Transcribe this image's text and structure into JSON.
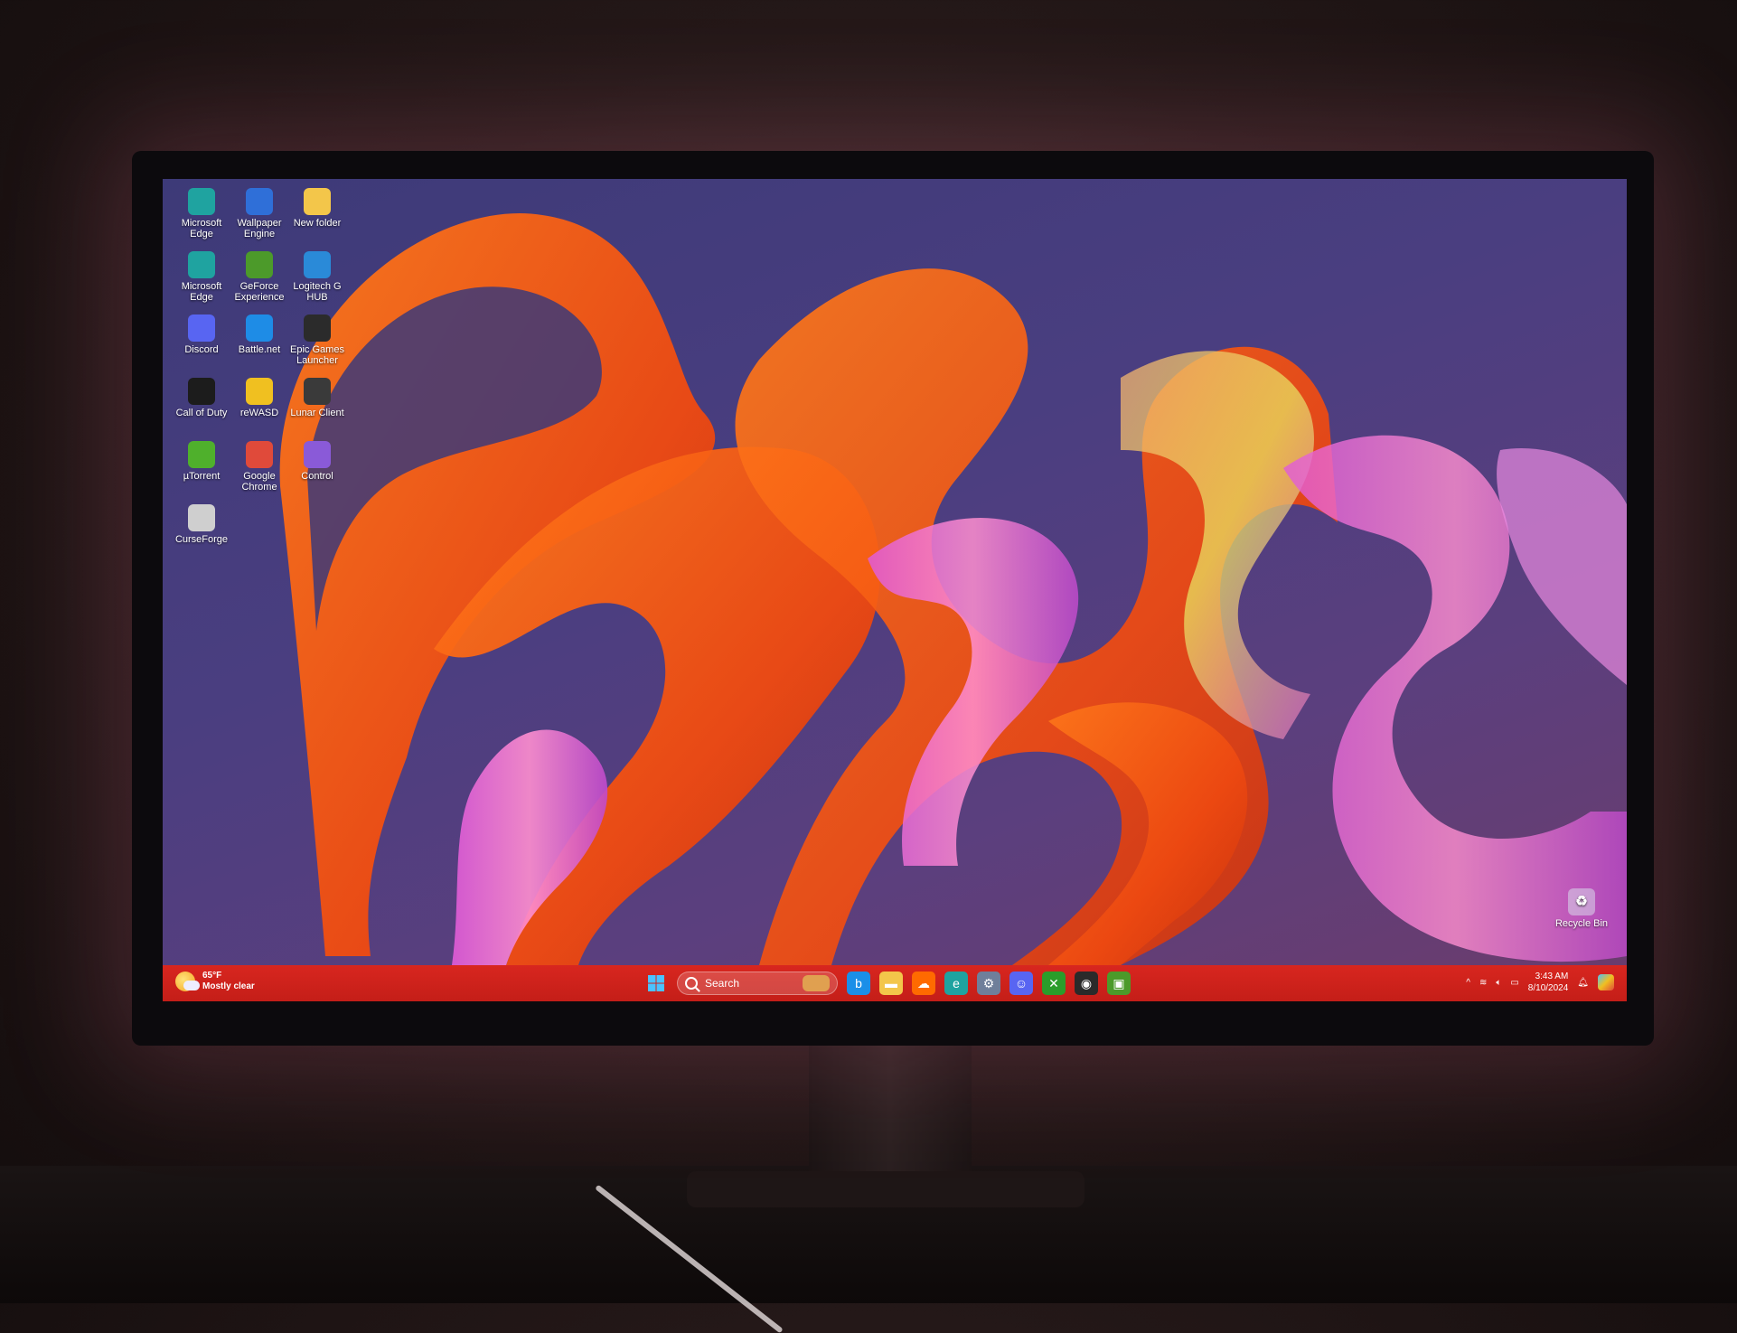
{
  "desktop": {
    "icons": [
      {
        "label": "Microsoft Edge",
        "icon": "edge-icon",
        "color": "#1fa3a0"
      },
      {
        "label": "Wallpaper Engine",
        "icon": "wallpaper-engine-icon",
        "color": "#2f6fd8"
      },
      {
        "label": "New folder",
        "icon": "folder-icon",
        "color": "#f3c64a"
      },
      {
        "label": "Microsoft Edge",
        "icon": "edge-icon",
        "color": "#1fa3a0"
      },
      {
        "label": "GeForce Experience",
        "icon": "geforce-icon",
        "color": "#4c9a2a"
      },
      {
        "label": "Logitech G HUB",
        "icon": "logitech-icon",
        "color": "#2a8ad8"
      },
      {
        "label": "Discord",
        "icon": "discord-icon",
        "color": "#5865f2"
      },
      {
        "label": "Battle.net",
        "icon": "battlenet-icon",
        "color": "#1e8ce6"
      },
      {
        "label": "Epic Games Launcher",
        "icon": "epic-icon",
        "color": "#2b2b2b"
      },
      {
        "label": "Call of Duty",
        "icon": "cod-icon",
        "color": "#1c1c1c"
      },
      {
        "label": "reWASD",
        "icon": "rewasd-icon",
        "color": "#f0c020"
      },
      {
        "label": "Lunar Client",
        "icon": "lunar-icon",
        "color": "#3a3a3a"
      },
      {
        "label": "µTorrent",
        "icon": "utorrent-icon",
        "color": "#4fb02c"
      },
      {
        "label": "Google Chrome",
        "icon": "chrome-icon",
        "color": "#e04a3a"
      },
      {
        "label": "Control",
        "icon": "control-icon",
        "color": "#8a5ad8"
      },
      {
        "label": "CurseForge",
        "icon": "curseforge-icon",
        "color": "#cfcfcf"
      }
    ],
    "recycle_bin": {
      "label": "Recycle Bin",
      "icon": "recycle-bin-icon"
    }
  },
  "taskbar": {
    "weather": {
      "temp": "65°F",
      "condition": "Mostly clear"
    },
    "search_label": "Search",
    "pinned": [
      {
        "name": "bing-icon",
        "color": "#1b8fe8",
        "glyph": "b"
      },
      {
        "name": "file-explorer-icon",
        "color": "#f3c64a",
        "glyph": "▬"
      },
      {
        "name": "soundcloud-icon",
        "color": "#ff6a00",
        "glyph": "☁"
      },
      {
        "name": "edge-icon",
        "color": "#1fa3a0",
        "glyph": "e"
      },
      {
        "name": "settings-icon",
        "color": "#6f7f9a",
        "glyph": "⚙"
      },
      {
        "name": "discord-icon",
        "color": "#5865f2",
        "glyph": "☺"
      },
      {
        "name": "xbox-icon",
        "color": "#2a9d2a",
        "glyph": "✕"
      },
      {
        "name": "obs-icon",
        "color": "#2a2a2a",
        "glyph": "◉"
      },
      {
        "name": "nvidia-icon",
        "color": "#4c9a2a",
        "glyph": "▣"
      }
    ],
    "clock": {
      "time": "3:43 AM",
      "date": "8/10/2024"
    }
  }
}
